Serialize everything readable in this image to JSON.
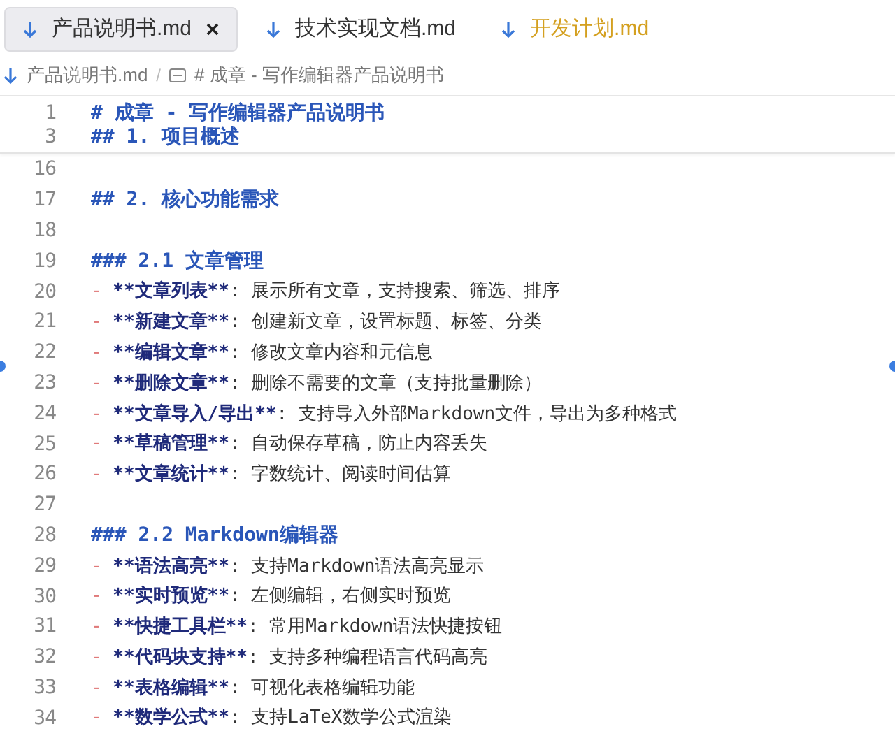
{
  "tabs": [
    {
      "label": "产品说明书.md",
      "selected": true,
      "color": "#333333",
      "closable": true
    },
    {
      "label": "技术实现文档.md",
      "selected": false,
      "color": "#333333",
      "closable": false
    },
    {
      "label": "开发计划.md",
      "selected": false,
      "color": "#d4a020",
      "closable": false
    }
  ],
  "breadcrumb": {
    "file": "产品说明书.md",
    "separator": "/",
    "section": "# 成章 - 写作编辑器产品说明书"
  },
  "sticky_lines": [
    {
      "number": "1",
      "kind": "heading",
      "text": "# 成章 - 写作编辑器产品说明书"
    },
    {
      "number": "3",
      "kind": "heading",
      "text": "## 1. 项目概述"
    }
  ],
  "lines": [
    {
      "number": "16",
      "kind": "blank"
    },
    {
      "number": "17",
      "kind": "heading",
      "text": "## 2. 核心功能需求"
    },
    {
      "number": "18",
      "kind": "blank"
    },
    {
      "number": "19",
      "kind": "heading",
      "text": "### 2.1 文章管理"
    },
    {
      "number": "20",
      "kind": "item",
      "marker": "-",
      "bold": "**文章列表**",
      "text": ": 展示所有文章，支持搜索、筛选、排序"
    },
    {
      "number": "21",
      "kind": "item",
      "marker": "-",
      "bold": "**新建文章**",
      "text": ": 创建新文章，设置标题、标签、分类"
    },
    {
      "number": "22",
      "kind": "item",
      "marker": "-",
      "bold": "**编辑文章**",
      "text": ": 修改文章内容和元信息"
    },
    {
      "number": "23",
      "kind": "item",
      "marker": "-",
      "bold": "**删除文章**",
      "text": ": 删除不需要的文章（支持批量删除）"
    },
    {
      "number": "24",
      "kind": "item",
      "marker": "-",
      "bold": "**文章导入/导出**",
      "text": ": 支持导入外部Markdown文件，导出为多种格式"
    },
    {
      "number": "25",
      "kind": "item",
      "marker": "-",
      "bold": "**草稿管理**",
      "text": ": 自动保存草稿，防止内容丢失"
    },
    {
      "number": "26",
      "kind": "item",
      "marker": "-",
      "bold": "**文章统计**",
      "text": ": 字数统计、阅读时间估算"
    },
    {
      "number": "27",
      "kind": "blank"
    },
    {
      "number": "28",
      "kind": "heading",
      "text": "### 2.2 Markdown编辑器"
    },
    {
      "number": "29",
      "kind": "item",
      "marker": "-",
      "bold": "**语法高亮**",
      "text": ": 支持Markdown语法高亮显示"
    },
    {
      "number": "30",
      "kind": "item",
      "marker": "-",
      "bold": "**实时预览**",
      "text": ": 左侧编辑，右侧实时预览"
    },
    {
      "number": "31",
      "kind": "item",
      "marker": "-",
      "bold": "**快捷工具栏**",
      "text": ": 常用Markdown语法快捷按钮"
    },
    {
      "number": "32",
      "kind": "item",
      "marker": "-",
      "bold": "**代码块支持**",
      "text": ": 支持多种编程语言代码高亮"
    },
    {
      "number": "33",
      "kind": "item",
      "marker": "-",
      "bold": "**表格编辑**",
      "text": ": 可视化表格编辑功能"
    },
    {
      "number": "34",
      "kind": "item",
      "marker": "-",
      "bold": "**数学公式**",
      "text": ": 支持LaTeX数学公式渲染"
    }
  ]
}
